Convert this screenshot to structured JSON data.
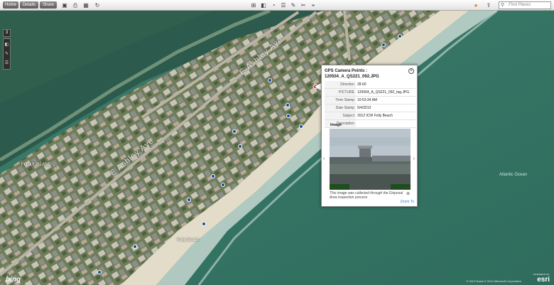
{
  "toolbar": {
    "home_label": "Home",
    "details_label": "Details",
    "share_label": "Share",
    "search_placeholder": "Find Places"
  },
  "map": {
    "left_tools": {
      "number": "3"
    },
    "labels": {
      "folly_island": "FOLLY ISLAND",
      "folly_beach": "Folly Beach",
      "atlantic_ocean": "Atlantic Ocean",
      "ashley_ave_1": "E Ashley Ave",
      "ashley_ave_2": "E Ashley Ave"
    },
    "copyright": "© 2012 Nokia © 2013 Microsoft Corporation",
    "bing": "bing",
    "esri": "esri",
    "esri_powered": "POWERED BY"
  },
  "popup": {
    "title": "GPS Camera Points : 120504_A_QS221_092.JPG",
    "close_glyph": "×",
    "attributes": [
      {
        "key": "Direction",
        "value": "28.60"
      },
      {
        "key": "PICTURE",
        "value": "120504_A_QS221_092_tag.JPG"
      },
      {
        "key": "Time Stamp",
        "value": "10:53:34 AM"
      },
      {
        "key": "Date Stamp",
        "value": "5/4/2012"
      },
      {
        "key": "Subject",
        "value": "2012 ICW Folly Beach"
      },
      {
        "key": "Description",
        "value": ""
      }
    ],
    "image_heading": "Image",
    "caption": "This image was collected through the Disposal Area inspection process",
    "zoom_to": "Zoom To",
    "prev_glyph": "‹",
    "next_glyph": "›"
  },
  "colors": {
    "ocean": "#3a7a6a",
    "marsh": "#2d5a4a",
    "sand": "#e8e2d0",
    "link": "#3b7dd8"
  }
}
